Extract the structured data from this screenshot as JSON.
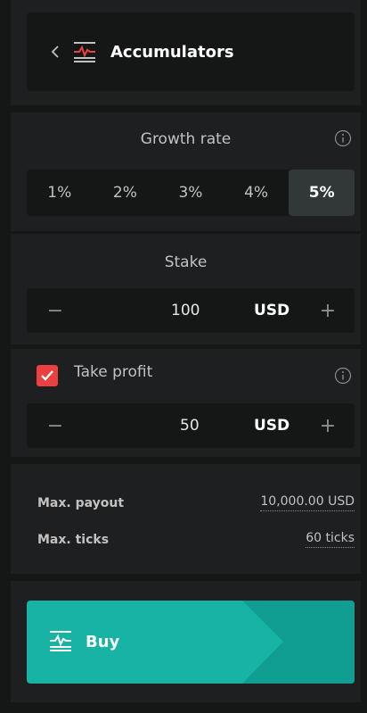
{
  "header": {
    "title": "Accumulators"
  },
  "growth_rate": {
    "label": "Growth rate",
    "options": [
      "1%",
      "2%",
      "3%",
      "4%",
      "5%"
    ],
    "selected": "5%"
  },
  "stake": {
    "label": "Stake",
    "minus": "−",
    "plus": "+",
    "value": "100",
    "currency": "USD"
  },
  "take_profit": {
    "label": "Take profit",
    "checked": true,
    "minus": "−",
    "plus": "+",
    "value": "50",
    "currency": "USD"
  },
  "payout": {
    "max_payout_label": "Max. payout",
    "max_payout_value": "10,000.00 USD",
    "max_ticks_label": "Max. ticks",
    "max_ticks_value": "60 ticks"
  },
  "buy": {
    "label": "Buy"
  },
  "colors": {
    "accent_red": "#ec3f3f",
    "buy_teal": "#17b3a4",
    "buy_teal_dark": "#0f9e91",
    "background": "#151717",
    "panel": "#1d1f20"
  },
  "icons": {
    "back": "chevron-left-icon",
    "trade_type": "accumulators-icon",
    "info": "info-icon",
    "checkbox": "checkmark-icon",
    "buy": "accumulators-icon"
  }
}
